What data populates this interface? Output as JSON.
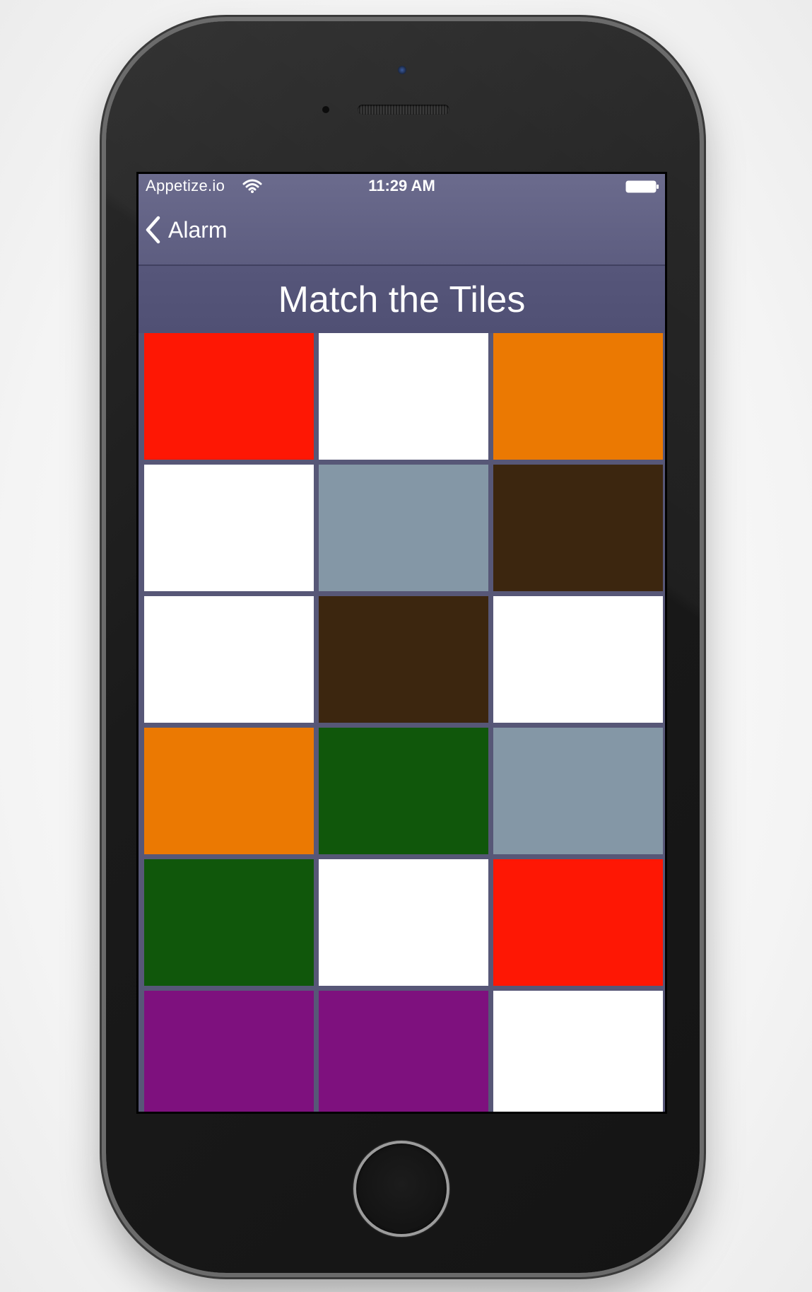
{
  "status_bar": {
    "carrier": "Appetize.io",
    "time": "11:29 AM"
  },
  "nav": {
    "back_label": "Alarm"
  },
  "title": "Match the Tiles",
  "tiles": [
    {
      "color": "#fe1704"
    },
    {
      "color": "#ffffff"
    },
    {
      "color": "#eb7902"
    },
    {
      "color": "#ffffff"
    },
    {
      "color": "#8497a6"
    },
    {
      "color": "#3c260f"
    },
    {
      "color": "#ffffff"
    },
    {
      "color": "#3c260f"
    },
    {
      "color": "#ffffff"
    },
    {
      "color": "#eb7902"
    },
    {
      "color": "#10570b"
    },
    {
      "color": "#8497a6"
    },
    {
      "color": "#10570b"
    },
    {
      "color": "#ffffff"
    },
    {
      "color": "#fe1704"
    },
    {
      "color": "#7e117e"
    },
    {
      "color": "#7e117e"
    },
    {
      "color": "#ffffff"
    }
  ]
}
